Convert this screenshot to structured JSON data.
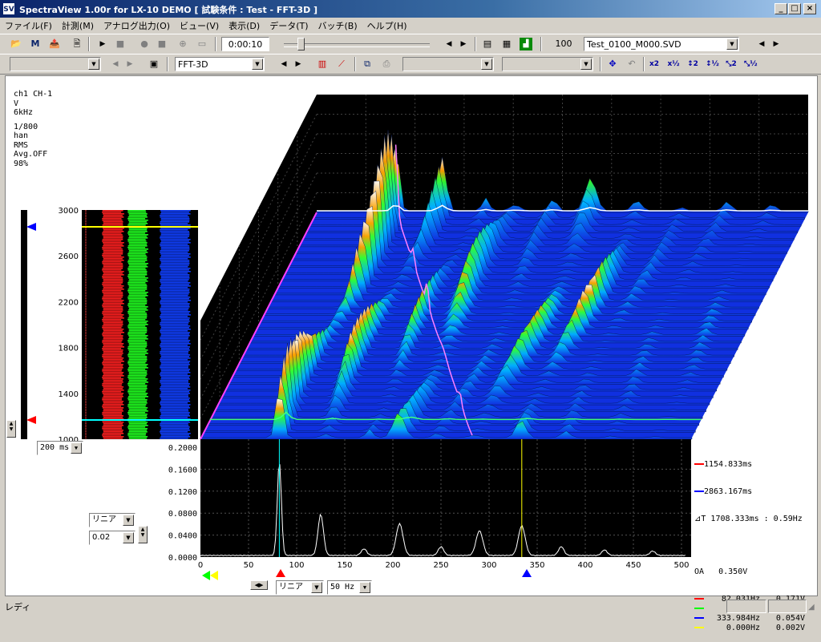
{
  "window": {
    "logo": "SV",
    "title": "SpectraView 1.00r for LX-10 DEMO [ 試験条件 : Test - FFT-3D ]",
    "min_label": "_",
    "max_label": "□",
    "close_label": "×"
  },
  "menu": [
    "ファイル(F)",
    "計測(M)",
    "アナログ出力(O)",
    "ビュー(V)",
    "表示(D)",
    "データ(T)",
    "バッチ(B)",
    "ヘルプ(H)"
  ],
  "toolbar1": {
    "time": "0:00:10",
    "slider_fraction": 0.1,
    "count": "100",
    "file": "Test_0100_M000.SVD"
  },
  "toolbar2": {
    "mode": "FFT-3D"
  },
  "info": {
    "lines": [
      "ch1 CH-1",
      "V",
      "6kHz",
      "",
      "1/800",
      "han",
      "RMS",
      "Avg.OFF",
      "98%"
    ]
  },
  "waterfall": {
    "y_ticks": [
      "3000",
      "2600",
      "2200",
      "1800",
      "1400",
      "1000"
    ],
    "time_unit": "200 ms"
  },
  "spectrum": {
    "y_ticks": [
      "0.2000",
      "0.1600",
      "0.1200",
      "0.0800",
      "0.0400",
      "0.0000"
    ],
    "x_ticks": [
      "0",
      "50",
      "100",
      "150",
      "200",
      "250",
      "300",
      "350",
      "400",
      "450",
      "500"
    ],
    "scale": "リニア",
    "step": "0.02",
    "freq_scale": "リニア",
    "freq_unit": "50 Hz"
  },
  "legend": {
    "t1": "1154.833ms",
    "t2": "2863.167ms",
    "dt": "⊿T 1708.333ms : 0.59Hz",
    "oa_label": "OA",
    "oa_value": "0.350V",
    "rows": [
      {
        "color": "#ff0000",
        "freq": "82.031Hz",
        "value": "0.171V"
      },
      {
        "color": "#00ff00",
        "freq": "0.000Hz",
        "value": "0.002V"
      },
      {
        "color": "#0000ff",
        "freq": "333.984Hz",
        "value": "0.054V"
      },
      {
        "color": "#ffff00",
        "freq": "0.000Hz",
        "value": "0.002V"
      }
    ]
  },
  "status": {
    "text": "レディ"
  },
  "colors": {
    "plot_bg": "#000000",
    "surface_base": "#1030e0",
    "marker_red": "#ff0000",
    "marker_blue": "#0000ff",
    "marker_yellow": "#ffff00",
    "marker_cyan": "#00ffff"
  }
}
